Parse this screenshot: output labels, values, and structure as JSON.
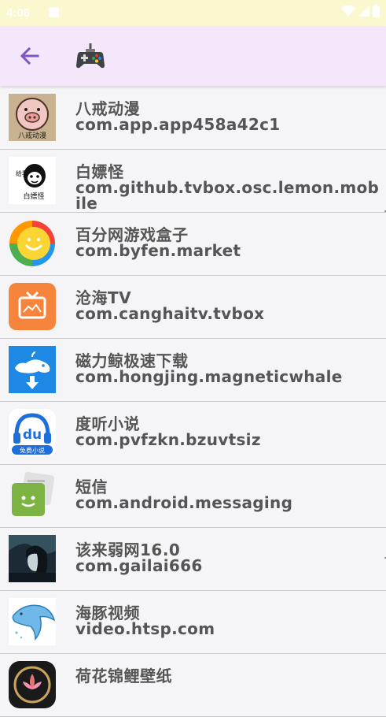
{
  "status": {
    "time": "4:06"
  },
  "header": {
    "back_icon": "arrow-back-icon",
    "app_icon": "gamepad-icon"
  },
  "apps": [
    {
      "name": "八戒动漫",
      "package": "com.app.app458a42c1"
    },
    {
      "name": "白嫖怪",
      "package": "com.github.tvbox.osc.lemon.mobile"
    },
    {
      "name": "百分网游戏盒子",
      "package": "com.byfen.market"
    },
    {
      "name": "沧海TV",
      "package": "com.canghaitv.tvbox"
    },
    {
      "name": "磁力鲸极速下载",
      "package": "com.hongjing.magneticwhale"
    },
    {
      "name": "度听小说",
      "package": "com.pvfzkn.bzuvtsiz"
    },
    {
      "name": "短信",
      "package": "com.android.messaging"
    },
    {
      "name": "该来弱网16.0",
      "package": "com.gailai666"
    },
    {
      "name": "海豚视频",
      "package": "video.htsp.com"
    },
    {
      "name": "荷花锦鲤壁纸",
      "package": ""
    }
  ],
  "icon_text": {
    "bajie": "八戒动漫",
    "baipiao_top": "给我",
    "baipiao_bottom": "白嫖怪",
    "dushu": "du",
    "dushu_sub": "免费小说"
  },
  "colors": {
    "status_bar": "#fbf8cf",
    "app_bar": "#f4e6fb",
    "accent": "#7e57c2",
    "text": "#555555"
  }
}
